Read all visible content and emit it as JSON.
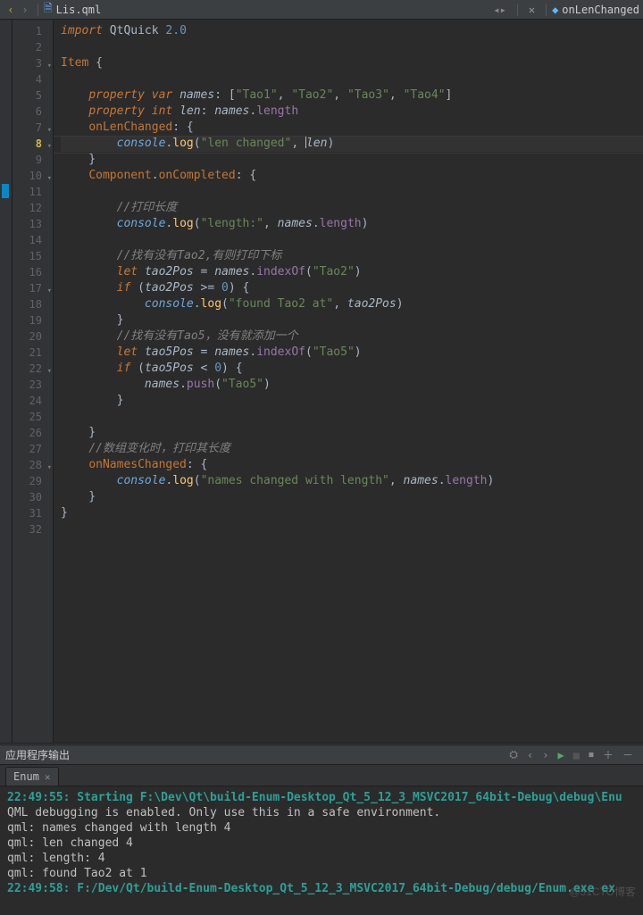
{
  "toolbar": {
    "file_name": "Lis.qml",
    "symbol": "onLenChanged"
  },
  "editor": {
    "current_line": 8,
    "fold_lines": [
      3,
      7,
      8,
      10,
      17,
      22,
      28
    ],
    "rail_mark_line": 11,
    "lines": [
      {
        "n": 1,
        "seg": [
          {
            "c": "kw",
            "t": "import"
          },
          {
            "c": "mod",
            "t": " QtQuick "
          },
          {
            "c": "num",
            "t": "2.0"
          }
        ]
      },
      {
        "n": 2,
        "seg": []
      },
      {
        "n": 3,
        "seg": [
          {
            "c": "type",
            "t": "Item"
          },
          {
            "c": "punct",
            "t": " {"
          }
        ]
      },
      {
        "n": 4,
        "seg": []
      },
      {
        "n": 5,
        "seg": [
          {
            "c": "punct",
            "t": "    "
          },
          {
            "c": "kw",
            "t": "property"
          },
          {
            "c": "punct",
            "t": " "
          },
          {
            "c": "kw",
            "t": "var"
          },
          {
            "c": "punct",
            "t": " "
          },
          {
            "c": "ident",
            "t": "names"
          },
          {
            "c": "punct",
            "t": ": ["
          },
          {
            "c": "str",
            "t": "\"Tao1\""
          },
          {
            "c": "punct",
            "t": ", "
          },
          {
            "c": "str",
            "t": "\"Tao2\""
          },
          {
            "c": "punct",
            "t": ", "
          },
          {
            "c": "str",
            "t": "\"Tao3\""
          },
          {
            "c": "punct",
            "t": ", "
          },
          {
            "c": "str",
            "t": "\"Tao4\""
          },
          {
            "c": "punct",
            "t": "]"
          }
        ]
      },
      {
        "n": 6,
        "seg": [
          {
            "c": "punct",
            "t": "    "
          },
          {
            "c": "kw",
            "t": "property"
          },
          {
            "c": "punct",
            "t": " "
          },
          {
            "c": "kw",
            "t": "int"
          },
          {
            "c": "punct",
            "t": " "
          },
          {
            "c": "ident",
            "t": "len"
          },
          {
            "c": "punct",
            "t": ": "
          },
          {
            "c": "ident",
            "t": "names"
          },
          {
            "c": "punct",
            "t": "."
          },
          {
            "c": "prop",
            "t": "length"
          }
        ]
      },
      {
        "n": 7,
        "seg": [
          {
            "c": "punct",
            "t": "    "
          },
          {
            "c": "sig",
            "t": "onLenChanged"
          },
          {
            "c": "punct",
            "t": ": {"
          }
        ]
      },
      {
        "n": 8,
        "seg": [
          {
            "c": "punct",
            "t": "        "
          },
          {
            "c": "obj",
            "t": "console"
          },
          {
            "c": "punct",
            "t": "."
          },
          {
            "c": "func",
            "t": "log"
          },
          {
            "c": "punct",
            "t": "("
          },
          {
            "c": "str",
            "t": "\"len changed\""
          },
          {
            "c": "punct",
            "t": ", "
          },
          {
            "c": "cursor",
            "t": ""
          },
          {
            "c": "ident",
            "t": "len"
          },
          {
            "c": "punct",
            "t": ")"
          }
        ]
      },
      {
        "n": 9,
        "seg": [
          {
            "c": "punct",
            "t": "    }"
          }
        ]
      },
      {
        "n": 10,
        "seg": [
          {
            "c": "punct",
            "t": "    "
          },
          {
            "c": "type",
            "t": "Component"
          },
          {
            "c": "punct",
            "t": "."
          },
          {
            "c": "sig",
            "t": "onCompleted"
          },
          {
            "c": "punct",
            "t": ": {"
          }
        ]
      },
      {
        "n": 11,
        "seg": []
      },
      {
        "n": 12,
        "seg": [
          {
            "c": "punct",
            "t": "        "
          },
          {
            "c": "cmt",
            "t": "//打印长度"
          }
        ]
      },
      {
        "n": 13,
        "seg": [
          {
            "c": "punct",
            "t": "        "
          },
          {
            "c": "obj",
            "t": "console"
          },
          {
            "c": "punct",
            "t": "."
          },
          {
            "c": "func",
            "t": "log"
          },
          {
            "c": "punct",
            "t": "("
          },
          {
            "c": "str",
            "t": "\"length:\""
          },
          {
            "c": "punct",
            "t": ", "
          },
          {
            "c": "ident",
            "t": "names"
          },
          {
            "c": "punct",
            "t": "."
          },
          {
            "c": "prop",
            "t": "length"
          },
          {
            "c": "punct",
            "t": ")"
          }
        ]
      },
      {
        "n": 14,
        "seg": []
      },
      {
        "n": 15,
        "seg": [
          {
            "c": "punct",
            "t": "        "
          },
          {
            "c": "cmt",
            "t": "//找有没有Tao2,有则打印下标"
          }
        ]
      },
      {
        "n": 16,
        "seg": [
          {
            "c": "punct",
            "t": "        "
          },
          {
            "c": "kw",
            "t": "let"
          },
          {
            "c": "punct",
            "t": " "
          },
          {
            "c": "ident",
            "t": "tao2Pos"
          },
          {
            "c": "punct",
            "t": " = "
          },
          {
            "c": "ident",
            "t": "names"
          },
          {
            "c": "punct",
            "t": "."
          },
          {
            "c": "prop",
            "t": "indexOf"
          },
          {
            "c": "punct",
            "t": "("
          },
          {
            "c": "str",
            "t": "\"Tao2\""
          },
          {
            "c": "punct",
            "t": ")"
          }
        ]
      },
      {
        "n": 17,
        "seg": [
          {
            "c": "punct",
            "t": "        "
          },
          {
            "c": "kw",
            "t": "if"
          },
          {
            "c": "punct",
            "t": " ("
          },
          {
            "c": "ident",
            "t": "tao2Pos"
          },
          {
            "c": "punct",
            "t": " >= "
          },
          {
            "c": "num",
            "t": "0"
          },
          {
            "c": "punct",
            "t": ") {"
          }
        ]
      },
      {
        "n": 18,
        "seg": [
          {
            "c": "punct",
            "t": "            "
          },
          {
            "c": "obj",
            "t": "console"
          },
          {
            "c": "punct",
            "t": "."
          },
          {
            "c": "func",
            "t": "log"
          },
          {
            "c": "punct",
            "t": "("
          },
          {
            "c": "str",
            "t": "\"found Tao2 at\""
          },
          {
            "c": "punct",
            "t": ", "
          },
          {
            "c": "ident",
            "t": "tao2Pos"
          },
          {
            "c": "punct",
            "t": ")"
          }
        ]
      },
      {
        "n": 19,
        "seg": [
          {
            "c": "punct",
            "t": "        }"
          }
        ]
      },
      {
        "n": 20,
        "seg": [
          {
            "c": "punct",
            "t": "        "
          },
          {
            "c": "cmt",
            "t": "//找有没有Tao5，没有就添加一个"
          }
        ]
      },
      {
        "n": 21,
        "seg": [
          {
            "c": "punct",
            "t": "        "
          },
          {
            "c": "kw",
            "t": "let"
          },
          {
            "c": "punct",
            "t": " "
          },
          {
            "c": "ident",
            "t": "tao5Pos"
          },
          {
            "c": "punct",
            "t": " = "
          },
          {
            "c": "ident",
            "t": "names"
          },
          {
            "c": "punct",
            "t": "."
          },
          {
            "c": "prop",
            "t": "indexOf"
          },
          {
            "c": "punct",
            "t": "("
          },
          {
            "c": "str",
            "t": "\"Tao5\""
          },
          {
            "c": "punct",
            "t": ")"
          }
        ]
      },
      {
        "n": 22,
        "seg": [
          {
            "c": "punct",
            "t": "        "
          },
          {
            "c": "kw",
            "t": "if"
          },
          {
            "c": "punct",
            "t": " ("
          },
          {
            "c": "ident",
            "t": "tao5Pos"
          },
          {
            "c": "punct",
            "t": " < "
          },
          {
            "c": "num",
            "t": "0"
          },
          {
            "c": "punct",
            "t": ") {"
          }
        ]
      },
      {
        "n": 23,
        "seg": [
          {
            "c": "punct",
            "t": "            "
          },
          {
            "c": "ident",
            "t": "names"
          },
          {
            "c": "punct",
            "t": "."
          },
          {
            "c": "prop",
            "t": "push"
          },
          {
            "c": "punct",
            "t": "("
          },
          {
            "c": "str",
            "t": "\"Tao5\""
          },
          {
            "c": "punct",
            "t": ")"
          }
        ]
      },
      {
        "n": 24,
        "seg": [
          {
            "c": "punct",
            "t": "        }"
          }
        ]
      },
      {
        "n": 25,
        "seg": []
      },
      {
        "n": 26,
        "seg": [
          {
            "c": "punct",
            "t": "    }"
          }
        ]
      },
      {
        "n": 27,
        "seg": [
          {
            "c": "punct",
            "t": "    "
          },
          {
            "c": "cmt",
            "t": "//数组变化时，打印其长度"
          }
        ]
      },
      {
        "n": 28,
        "seg": [
          {
            "c": "punct",
            "t": "    "
          },
          {
            "c": "sig",
            "t": "onNamesChanged"
          },
          {
            "c": "punct",
            "t": ": {"
          }
        ]
      },
      {
        "n": 29,
        "seg": [
          {
            "c": "punct",
            "t": "        "
          },
          {
            "c": "obj",
            "t": "console"
          },
          {
            "c": "punct",
            "t": "."
          },
          {
            "c": "func",
            "t": "log"
          },
          {
            "c": "punct",
            "t": "("
          },
          {
            "c": "str",
            "t": "\"names changed with length\""
          },
          {
            "c": "punct",
            "t": ", "
          },
          {
            "c": "ident",
            "t": "names"
          },
          {
            "c": "punct",
            "t": "."
          },
          {
            "c": "prop",
            "t": "length"
          },
          {
            "c": "punct",
            "t": ")"
          }
        ]
      },
      {
        "n": 30,
        "seg": [
          {
            "c": "punct",
            "t": "    }"
          }
        ]
      },
      {
        "n": 31,
        "seg": [
          {
            "c": "punct",
            "t": "}"
          }
        ]
      },
      {
        "n": 32,
        "seg": []
      }
    ]
  },
  "output": {
    "title": "应用程序输出",
    "tab": "Enum",
    "lines": [
      {
        "cls": "launch",
        "t": "22:49:55: Starting F:\\Dev\\Qt\\build-Enum-Desktop_Qt_5_12_3_MSVC2017_64bit-Debug\\debug\\Enu"
      },
      {
        "cls": "info",
        "t": "QML debugging is enabled. Only use this in a safe environment."
      },
      {
        "cls": "info",
        "t": "qml: names changed with length 4"
      },
      {
        "cls": "info",
        "t": "qml: len changed 4"
      },
      {
        "cls": "info",
        "t": "qml: length: 4"
      },
      {
        "cls": "info",
        "t": "qml: found Tao2 at 1"
      },
      {
        "cls": "launch",
        "t": "22:49:58: F:/Dev/Qt/build-Enum-Desktop_Qt_5_12_3_MSVC2017_64bit-Debug/debug/Enum.exe ex"
      }
    ]
  },
  "watermark": "@51CTO博客"
}
